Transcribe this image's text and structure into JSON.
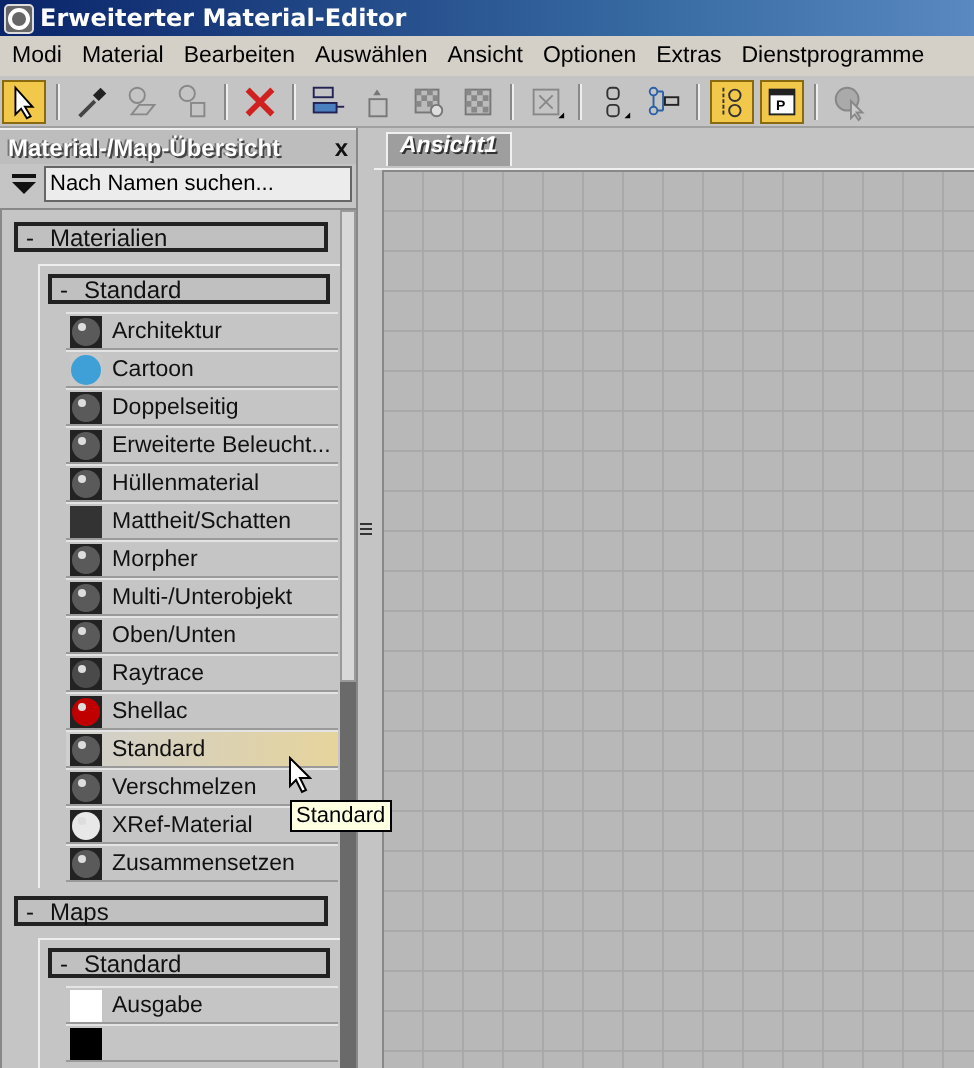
{
  "window": {
    "title": "Erweiterter Material-Editor"
  },
  "menu": [
    "Modi",
    "Material",
    "Bearbeiten",
    "Auswählen",
    "Ansicht",
    "Optionen",
    "Extras",
    "Dienstprogramme"
  ],
  "toolbar": [
    {
      "kind": "select",
      "active": true
    },
    {
      "kind": "separator"
    },
    {
      "kind": "eyedropper",
      "active": false
    },
    {
      "kind": "pick",
      "active": false
    },
    {
      "kind": "put",
      "active": false
    },
    {
      "kind": "separator"
    },
    {
      "kind": "delete",
      "active": false
    },
    {
      "kind": "separator"
    },
    {
      "kind": "layout",
      "active": false
    },
    {
      "kind": "upload",
      "active": false
    },
    {
      "kind": "checker-bulb",
      "active": false
    },
    {
      "kind": "checker",
      "active": false
    },
    {
      "kind": "separator"
    },
    {
      "kind": "frame",
      "active": false
    },
    {
      "kind": "separator"
    },
    {
      "kind": "nodes",
      "active": false
    },
    {
      "kind": "tree",
      "active": false
    },
    {
      "kind": "separator"
    },
    {
      "kind": "node-list",
      "active": true
    },
    {
      "kind": "param",
      "active": true,
      "label": "P"
    },
    {
      "kind": "separator"
    },
    {
      "kind": "render",
      "active": false
    }
  ],
  "browser": {
    "title": "Material-/Map-Übersicht",
    "close": "x",
    "search": {
      "placeholder": "Nach Namen suchen..."
    },
    "groups": [
      {
        "toggle": "-",
        "label": "Materialien",
        "children": [
          {
            "toggle": "-",
            "label": "Standard",
            "items": [
              {
                "label": "Architektur",
                "kind": "sphere",
                "color": "#5a5a5a",
                "selected": false
              },
              {
                "label": "Cartoon",
                "kind": "disc",
                "color": "#3fa0d8",
                "selected": false
              },
              {
                "label": "Doppelseitig",
                "kind": "sphere",
                "color": "#5a5a5a",
                "selected": false
              },
              {
                "label": "Erweiterte Beleucht...",
                "kind": "sphere",
                "color": "#5a5a5a",
                "selected": false
              },
              {
                "label": "Hüllenmaterial",
                "kind": "sphere",
                "color": "#5a5a5a",
                "selected": false
              },
              {
                "label": "Mattheit/Schatten",
                "kind": "square",
                "color": "#333333",
                "selected": false
              },
              {
                "label": "Morpher",
                "kind": "sphere",
                "color": "#5a5a5a",
                "selected": false
              },
              {
                "label": "Multi-/Unterobjekt",
                "kind": "sphere",
                "color": "#5a5a5a",
                "selected": false
              },
              {
                "label": "Oben/Unten",
                "kind": "sphere",
                "color": "#5a5a5a",
                "selected": false
              },
              {
                "label": "Raytrace",
                "kind": "sphere",
                "color": "#4a4a4a",
                "selected": false
              },
              {
                "label": "Shellac",
                "kind": "sphere",
                "color": "#c00000",
                "selected": false
              },
              {
                "label": "Standard",
                "kind": "sphere",
                "color": "#5a5a5a",
                "selected": true
              },
              {
                "label": "Verschmelzen",
                "kind": "sphere",
                "color": "#5a5a5a",
                "selected": false
              },
              {
                "label": "XRef-Material",
                "kind": "sphere",
                "color": "#e8e8e8",
                "selected": false
              },
              {
                "label": "Zusammensetzen",
                "kind": "sphere",
                "color": "#5a5a5a",
                "selected": false
              }
            ]
          }
        ]
      },
      {
        "toggle": "-",
        "label": "Maps",
        "children": [
          {
            "toggle": "-",
            "label": "Standard",
            "items": [
              {
                "label": "Ausgabe",
                "kind": "square",
                "color": "#ffffff",
                "selected": false
              },
              {
                "kind": "square",
                "color": "#000000",
                "selected": false
              }
            ]
          }
        ]
      }
    ]
  },
  "tooltip": "Standard",
  "viewport": {
    "tab": "Ansicht1"
  }
}
